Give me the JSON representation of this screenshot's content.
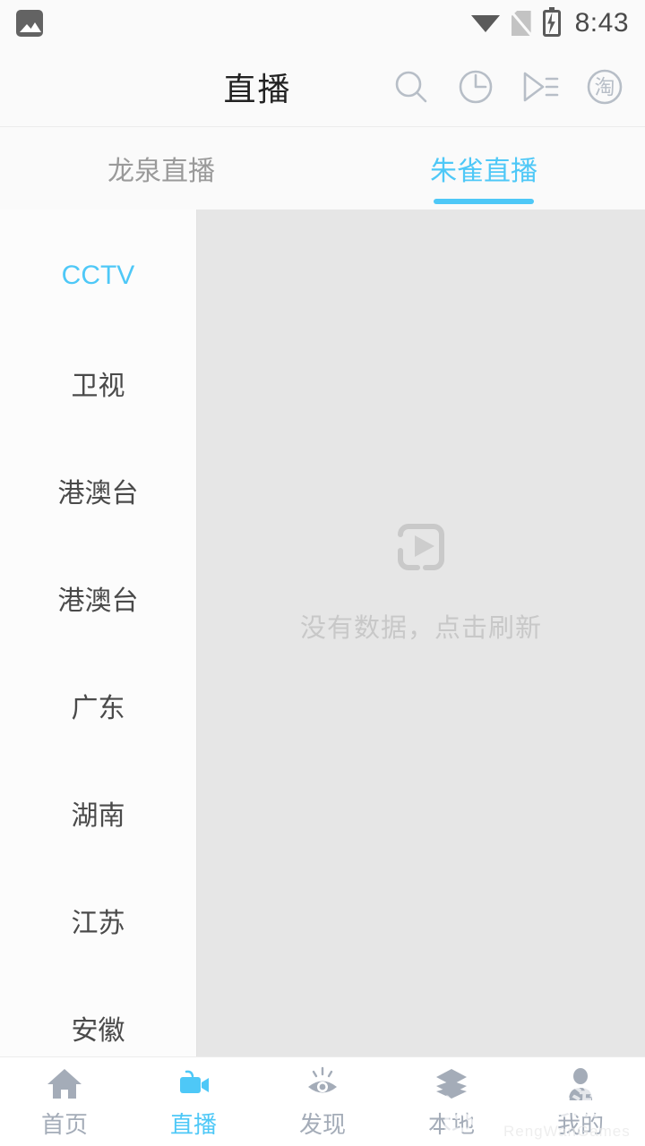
{
  "status_bar": {
    "time": "8:43",
    "icons": {
      "notification": "image-icon",
      "wifi": "wifi-icon",
      "signal": "no-sim-icon",
      "battery": "battery-charging-icon"
    }
  },
  "header": {
    "title": "直播",
    "actions": [
      {
        "name": "search-icon",
        "label": "搜索"
      },
      {
        "name": "history-clock-icon",
        "label": "历史"
      },
      {
        "name": "playlist-icon",
        "label": "播放列表"
      },
      {
        "name": "tao-badge-icon",
        "label": "淘"
      }
    ]
  },
  "tabs": {
    "items": [
      {
        "label": "龙泉直播",
        "active": false
      },
      {
        "label": "朱雀直播",
        "active": true
      }
    ]
  },
  "sidebar": {
    "items": [
      {
        "label": "CCTV",
        "active": true
      },
      {
        "label": "卫视",
        "active": false
      },
      {
        "label": "港澳台",
        "active": false
      },
      {
        "label": "港澳台",
        "active": false
      },
      {
        "label": "广东",
        "active": false
      },
      {
        "label": "湖南",
        "active": false
      },
      {
        "label": "江苏",
        "active": false
      },
      {
        "label": "安徽",
        "active": false
      }
    ]
  },
  "main": {
    "empty_state": {
      "icon": "video-placeholder-icon",
      "message": "没有数据，点击刷新"
    }
  },
  "bottom_nav": {
    "items": [
      {
        "label": "首页",
        "icon": "home-icon",
        "active": false
      },
      {
        "label": "直播",
        "icon": "video-camera-icon",
        "active": true
      },
      {
        "label": "发现",
        "icon": "eye-discover-icon",
        "active": false
      },
      {
        "label": "本地",
        "icon": "layers-icon",
        "active": false
      },
      {
        "label": "我的",
        "icon": "person-icon",
        "active": false
      }
    ]
  },
  "watermark": {
    "cn": "仍玩游戏",
    "en": "RengWanGames"
  },
  "colors": {
    "accent": "#4ec8f7",
    "sidebar_bg": "#fcfcfc",
    "content_bg": "#e6e6e6",
    "nav_inactive": "#a4acb8",
    "text_primary": "#4a4a4a"
  }
}
